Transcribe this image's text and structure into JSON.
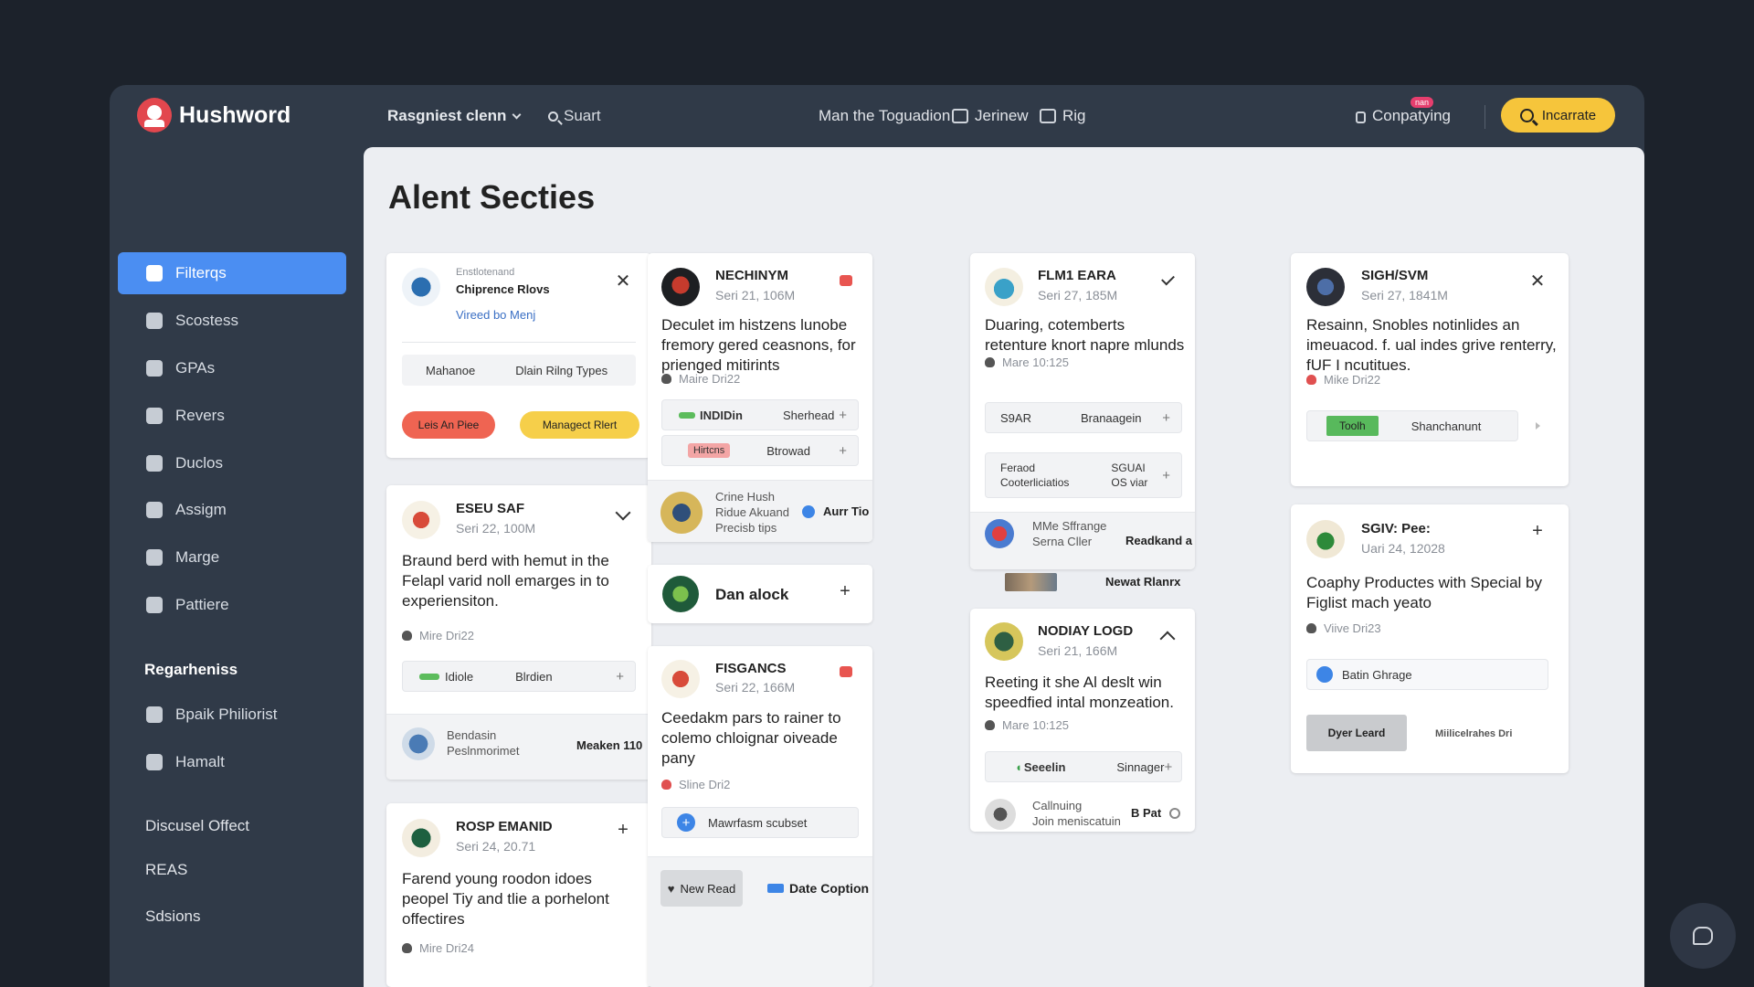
{
  "app": {
    "name": "Hushword"
  },
  "topbar": {
    "project": "Rasgniest clenn",
    "search": "Suart",
    "nav": [
      "Man the Toguadion",
      "Jerinew",
      "Rig",
      "Conpatying"
    ],
    "badge": "nan",
    "cta": "Incarrate"
  },
  "sidebar": {
    "items": [
      "Filterqs",
      "Scostess",
      "GPAs",
      "Revers",
      "Duclos",
      "Assigm",
      "Marge",
      "Pattiere"
    ],
    "section": "Regarheniss",
    "section_items": [
      "Bpaik Philiorist",
      "Hamalt"
    ],
    "links": [
      "Discusel Offect",
      "REAS",
      "Sdsions"
    ]
  },
  "main": {
    "title": "Alent Secties"
  },
  "cards": {
    "c1": {
      "org_small": "Enstlotenand",
      "name": "Chiprence Rlovs",
      "link": "Vireed bo Menj",
      "col1": "Mahanoe",
      "col2": "Dlain Rilng Types",
      "btn1": "Leis An Piee",
      "btn2": "Managect Rlert"
    },
    "c2": {
      "name": "ESEU SAF",
      "date": "Seri 22, 100M",
      "body": "Braund berd with hemut in the Felapl varid noll emarges in to experiensiton.",
      "meta": "Mire Dri22",
      "pill1": "Idiole",
      "pill2": "Blrdien",
      "foot_line1": "Bendasin",
      "foot_line2": "Peslnmorimet",
      "foot_right": "Meaken 110"
    },
    "c3": {
      "name": "ROSP EMANID",
      "date": "Seri 24, 20.71",
      "body": "Farend young roodon idoes peopel Tiy and tlie a porhelont offectires",
      "meta": "Mire Dri24"
    },
    "c4": {
      "name": "NECHINYM",
      "date": "Seri 21, 106M",
      "body": "Deculet im histzens lunobe fremory gered ceasnons, for prienged mitirints",
      "meta": "Maire Dri22",
      "pill1": "INDIDin",
      "pill2": "Sherhead",
      "pill3": "Hirtcns",
      "pill4": "Btrowad",
      "foot_line1": "Crine Hush",
      "foot_line2": "Ridue Akuand",
      "foot_line3": "Precisb tips",
      "foot_right": "Aurr Tio"
    },
    "c5": {
      "name": "Dan alock"
    },
    "c6": {
      "name": "FISGANCS",
      "date": "Seri 22, 166M",
      "body": "Ceedakm pars to rainer to colemo chloignar oiveade pany",
      "meta": "Sline Dri2",
      "pill": "Mawrfasm scubset",
      "btn1": "New Read",
      "btn2": "Date Coption"
    },
    "c7": {
      "name": "FLM1 EARA",
      "date": "Seri 27, 185M",
      "body": "Duaring, cotemberts retenture knort napre mlunds",
      "meta": "Mare 10:125",
      "pill1": "S9AR",
      "pill2": "Branaagein",
      "pill3a": "Feraod",
      "pill3b": "Cooterliciatios",
      "pill4a": "SGUAI",
      "pill4b": "OS viar",
      "foot_line1": "MMe Sffrange",
      "foot_line2": "Serna Cller",
      "foot_right": "Readkand a",
      "foot_right2": "Newat Rlanrx"
    },
    "c8": {
      "name": "NODIAY LOGD",
      "date": "Seri 21, 166M",
      "body": "Reeting it she Al deslt win speedfied intal monzeation.",
      "meta": "Mare 10:125",
      "pill1": "Seeelin",
      "pill2": "Sinnager",
      "foot_line1": "Callnuing",
      "foot_line2": "Join meniscatuin",
      "foot_right": "B Pat"
    },
    "c9": {
      "name": "SIGH/SVM",
      "date": "Seri 27, 1841M",
      "body": "Resainn, Snobles notinlides an imeuacod. f. ual indes grive renterry, fUF I ncutitues.",
      "meta": "Mike Dri22",
      "pill1": "Toolh",
      "pill2": "Shanchanunt"
    },
    "c10": {
      "name": "SGIV: Pee:",
      "date": "Uari 24, 12028",
      "body": "Coaphy Productes with Special by Figlist mach yeato",
      "meta": "Viive Dri23",
      "pill": "Batin Ghrage",
      "btn": "Dyer Leard",
      "right": "Miilicelrahes Dri"
    }
  }
}
